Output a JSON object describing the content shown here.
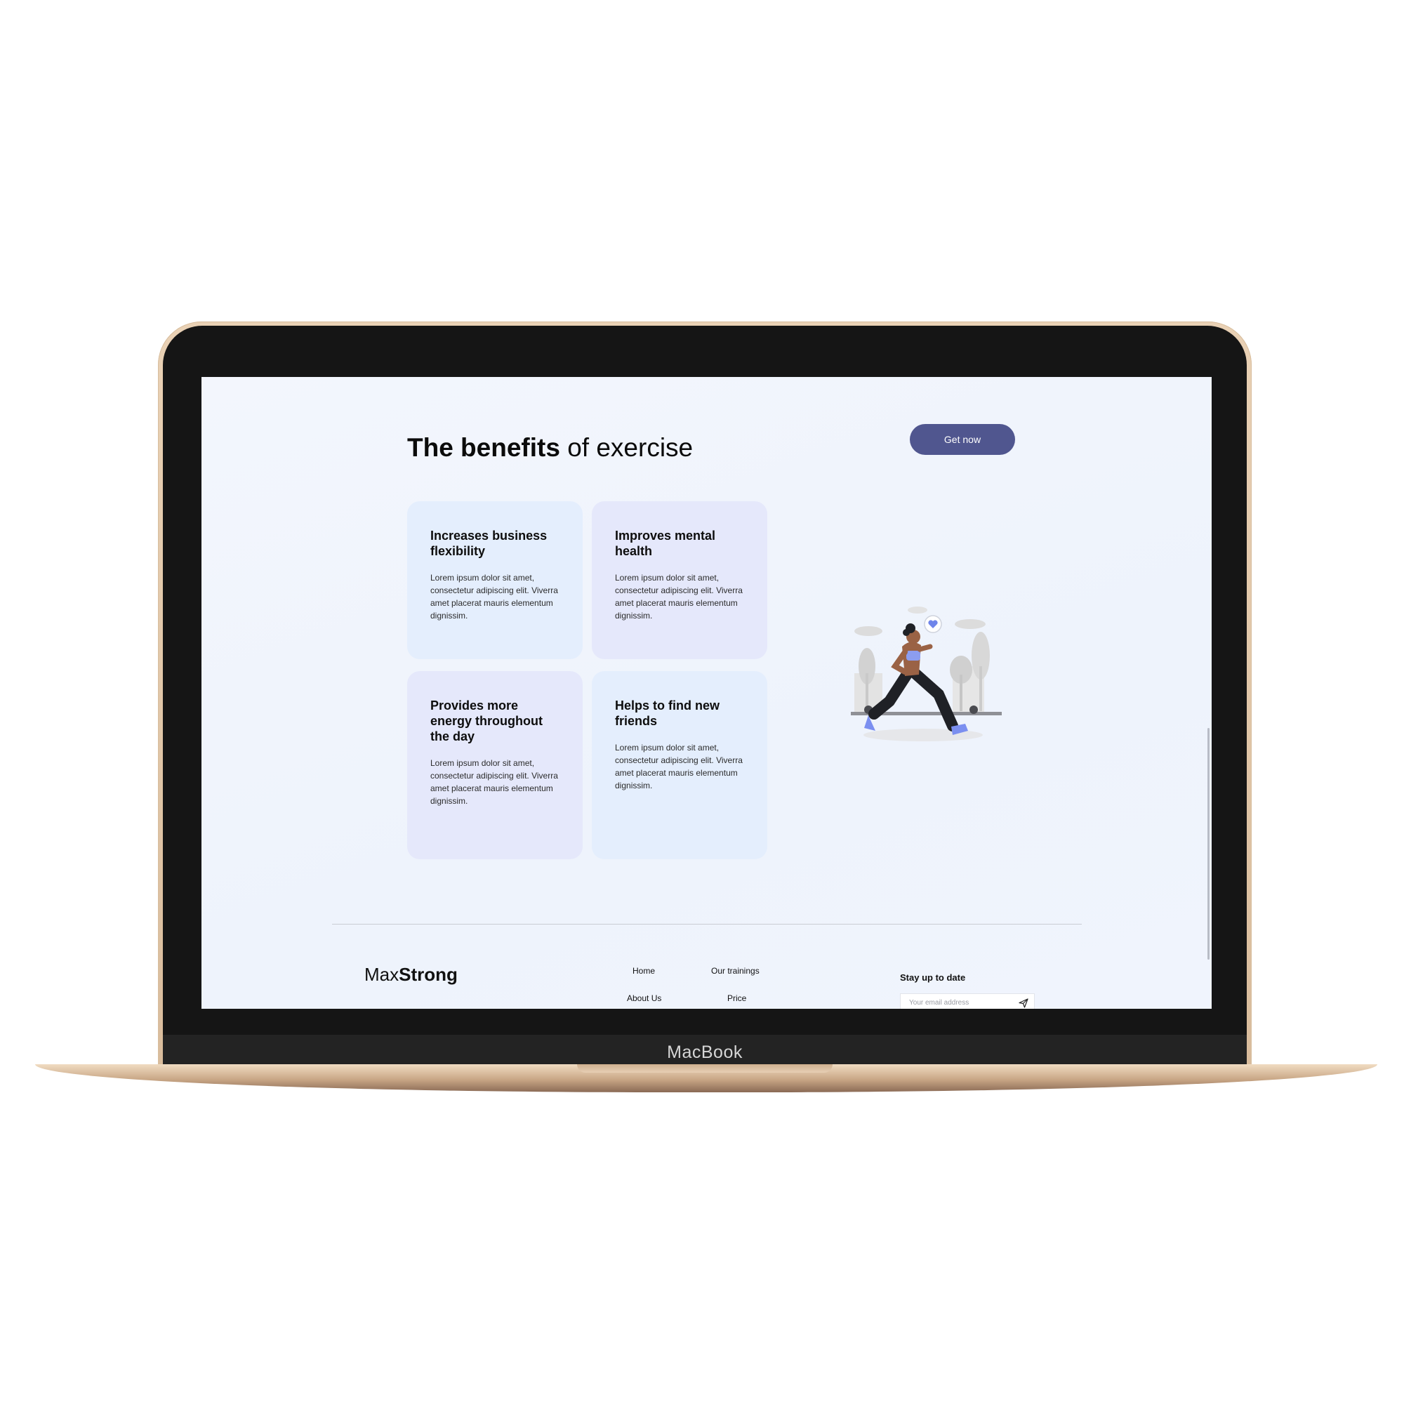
{
  "device": {
    "brand": "MacBook"
  },
  "hero": {
    "title_bold": "The benefits",
    "title_rest": " of exercise",
    "cta_label": "Get now"
  },
  "cards": [
    {
      "title": "Increases business flexibility",
      "body": "Lorem ipsum dolor sit amet, consectetur adipiscing elit. Viverra amet placerat mauris elementum dignissim.",
      "color": "#e4eefd"
    },
    {
      "title": "Improves mental health",
      "body": "Lorem ipsum dolor sit amet, consectetur adipiscing elit. Viverra amet placerat mauris elementum dignissim.",
      "color": "#e5e8fb"
    },
    {
      "title": "Provides more energy throughout the day",
      "body": "Lorem ipsum dolor sit amet, consectetur adipiscing elit. Viverra amet placerat mauris elementum dignissim.",
      "color": "#e5e8fb"
    },
    {
      "title": "Helps to find new friends",
      "body": "Lorem ipsum dolor sit amet, consectetur adipiscing elit. Viverra amet placerat mauris elementum dignissim.",
      "color": "#e4eefd"
    }
  ],
  "footer": {
    "logo_light": "Max",
    "logo_bold": "Strong",
    "nav": [
      "Home",
      "Our trainings",
      "About Us",
      "Price"
    ],
    "newsletter_title": "Stay up to date",
    "email_placeholder": "Your email address"
  },
  "colors": {
    "accent": "#50568f",
    "page_bg": "#f0f4fd",
    "card_blue": "#e4eefd",
    "card_violet": "#e5e8fb"
  },
  "icons": {
    "send": "send-icon",
    "illustration": "runner-illustration"
  }
}
